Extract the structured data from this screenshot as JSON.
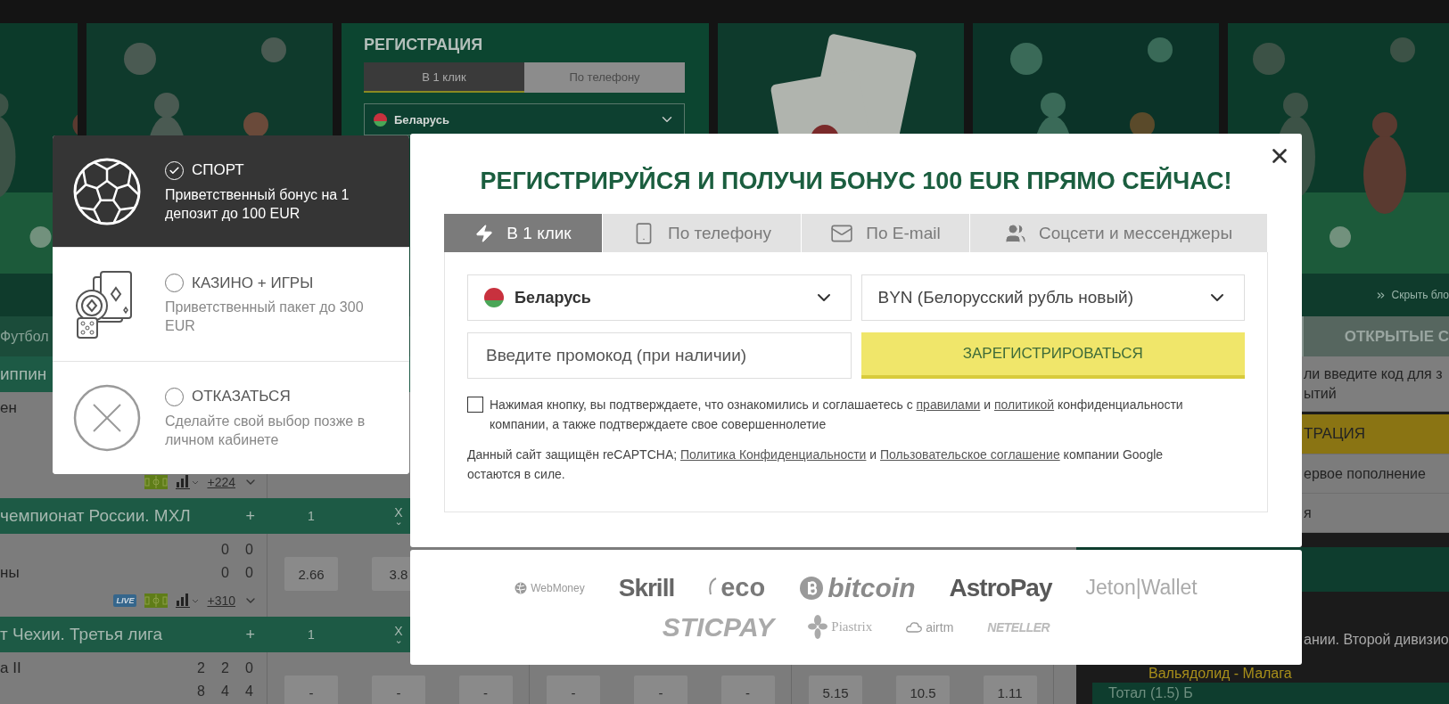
{
  "banner": {
    "slots": [
      {
        "kind": "picture"
      },
      {
        "kind": "picture"
      },
      {
        "kind": "registration",
        "title": "РЕГИСТРАЦИЯ",
        "tabs": [
          {
            "label": "В 1 клик",
            "selected": true
          },
          {
            "label": "По телефону",
            "selected": false
          }
        ],
        "country": "Беларусь"
      },
      {
        "kind": "picture"
      },
      {
        "kind": "picture"
      },
      {
        "kind": "picture"
      }
    ]
  },
  "sport_tab": "Футбол",
  "leagues": [
    {
      "title": "иппин",
      "events": [
        {
          "lines": [
            {
              "team": "ен"
            }
          ],
          "more": "+224"
        }
      ]
    },
    {
      "title": "чемпионат России. МХЛ",
      "plus": "+",
      "columns": [
        {
          "label": "1"
        },
        {
          "label": "X",
          "caret": "⌄"
        }
      ],
      "events": [
        {
          "lines": [
            {
              "scores": [
                "0",
                "0"
              ]
            },
            {
              "team": "ны",
              "scores": [
                "0",
                "0"
              ]
            }
          ],
          "badge": "LIVE",
          "more": "+310",
          "odds": [
            "2.66",
            "3.8"
          ]
        }
      ]
    },
    {
      "title": "т Чехии. Третья лига",
      "plus": "+",
      "columns": [
        {
          "label": "1"
        },
        {
          "label": "X",
          "caret": "⌄"
        }
      ],
      "events": [
        {
          "lines": [
            {
              "team": "а II",
              "scores": [
                "2",
                "2",
                "0"
              ]
            },
            {
              "scores": [
                "8",
                "4",
                "4"
              ]
            }
          ],
          "odds": [
            "-",
            "-",
            "-",
            "-",
            "-",
            "-",
            "5.15",
            "10.5",
            "1.11"
          ]
        }
      ]
    }
  ],
  "sidebar": {
    "hide_label": "Скрыть бло",
    "tab_label": "ОТКРЫТЫЕ С",
    "code_hint": [
      "ли введите код для з",
      "ытий"
    ],
    "registration": "ТРАЦИЯ",
    "menu": [
      "ервое пополнение",
      "я"
    ],
    "league": "ании. Второй дивизио",
    "match": "Вальядолид - Малага",
    "market": "Тотал (1.5) Б"
  },
  "bonus_options": [
    {
      "kind": "sport",
      "title": "СПОРТ",
      "text": "Приветственный бонус на 1 депозит до 100 EUR",
      "selected": true
    },
    {
      "kind": "casino",
      "title": "КАЗИНО + ИГРЫ",
      "text": "Приветственный пакет до 300 EUR",
      "selected": false
    },
    {
      "kind": "decline",
      "title": "ОТКАЗАТЬСЯ",
      "text": "Сделайте свой выбор позже в личном кабинете",
      "selected": false
    }
  ],
  "modal": {
    "title": "РЕГИСТРИРУЙСЯ И ПОЛУЧИ БОНУС 100 EUR ПРЯМО СЕЙЧАС!",
    "tabs": [
      {
        "kind": "click",
        "label": "В 1 клик",
        "selected": true
      },
      {
        "kind": "phone",
        "label": "По телефону",
        "selected": false
      },
      {
        "kind": "email",
        "label": "По E-mail",
        "selected": false
      },
      {
        "kind": "social",
        "label": "Соцсети и мессенджеры",
        "selected": false
      }
    ],
    "country": "Беларусь",
    "currency": "BYN (Белорусский рубль новый)",
    "promo": {
      "placeholder": "Введите промокод (при наличии)"
    },
    "submit": "ЗАРЕГИСТРИРОВАТЬСЯ",
    "consent": {
      "checked": false,
      "parts": [
        {
          "kind": "text",
          "text": "Нажимая кнопку, вы подтверждаете, что ознакомились и соглашаетесь с "
        },
        {
          "kind": "link",
          "text": "правилами"
        },
        {
          "kind": "text",
          "text": " и "
        },
        {
          "kind": "link",
          "text": "политикой"
        },
        {
          "kind": "text",
          "text": " конфиденциальности компании, а также подтверждаете свое совершеннолетие"
        }
      ]
    },
    "recaptcha": [
      {
        "kind": "text",
        "text": "Данный сайт защищён reCAPTCHA; "
      },
      {
        "kind": "link",
        "text": "Политика Конфиденциальности"
      },
      {
        "kind": "text",
        "text": " и "
      },
      {
        "kind": "link",
        "text": "Пользовательское соглашение"
      },
      {
        "kind": "text",
        "text": " компании Google остаются в силе."
      }
    ]
  },
  "payment_rows": [
    {
      "logos": [
        {
          "kind": "webmoney",
          "label": "WebMoney"
        },
        {
          "kind": "skrill",
          "label": "Skrill"
        },
        {
          "kind": "eco",
          "label": "eco"
        },
        {
          "kind": "bitcoin",
          "label": "bitcoin"
        },
        {
          "kind": "astropay",
          "label": "AstroPay"
        },
        {
          "kind": "jeton",
          "label": "Jeton|Wallet"
        }
      ]
    },
    {
      "logos": [
        {
          "kind": "sticpay",
          "label": "STICPAY"
        },
        {
          "kind": "piastrix",
          "label": "Piastrix"
        },
        {
          "kind": "airtm",
          "label": "airtm"
        },
        {
          "kind": "neteller",
          "label": "NETELLER"
        }
      ]
    }
  ]
}
